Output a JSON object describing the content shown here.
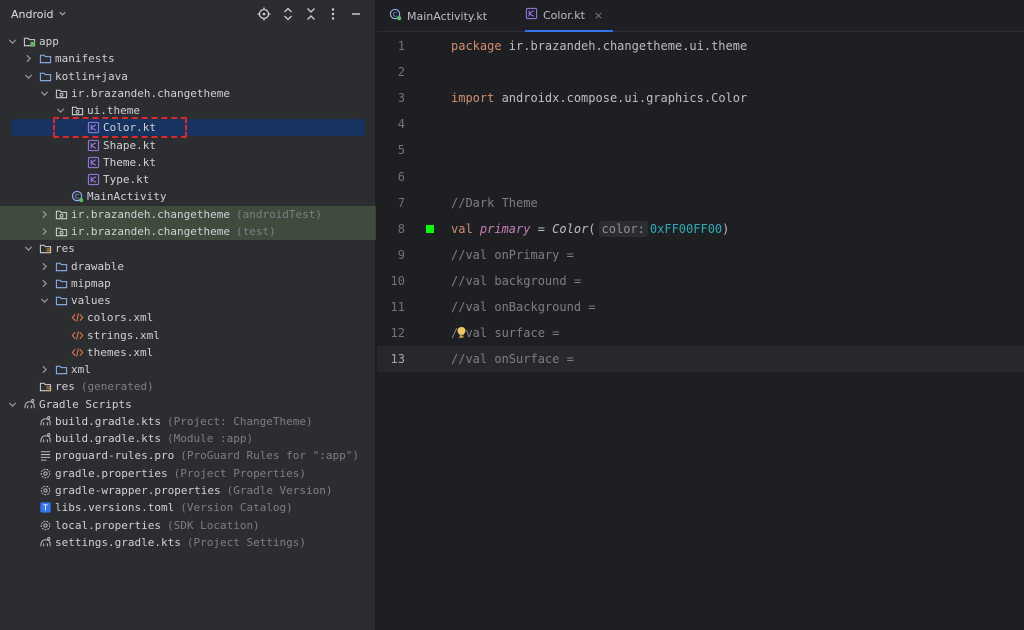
{
  "project_panel": {
    "view_label": "Android",
    "tree": [
      {
        "depth": 0,
        "label": "app",
        "hint": "",
        "icon": "module-folder-icon",
        "arrow": "down"
      },
      {
        "depth": 1,
        "label": "manifests",
        "hint": "",
        "icon": "folder-icon",
        "arrow": "right"
      },
      {
        "depth": 1,
        "label": "kotlin+java",
        "hint": "",
        "icon": "folder-icon",
        "arrow": "down"
      },
      {
        "depth": 2,
        "label": "ir.brazandeh.changetheme",
        "hint": "",
        "icon": "package-icon",
        "arrow": "down"
      },
      {
        "depth": 3,
        "label": "ui.theme",
        "hint": "",
        "icon": "package-icon",
        "arrow": "down"
      },
      {
        "depth": 4,
        "label": "Color.kt",
        "hint": "",
        "icon": "kotlin-file-icon",
        "arrow": "none",
        "selected": true
      },
      {
        "depth": 4,
        "label": "Shape.kt",
        "hint": "",
        "icon": "kotlin-file-icon",
        "arrow": "none"
      },
      {
        "depth": 4,
        "label": "Theme.kt",
        "hint": "",
        "icon": "kotlin-file-icon",
        "arrow": "none"
      },
      {
        "depth": 4,
        "label": "Type.kt",
        "hint": "",
        "icon": "kotlin-file-icon",
        "arrow": "none"
      },
      {
        "depth": 3,
        "label": "MainActivity",
        "hint": "",
        "icon": "activity-icon",
        "arrow": "none"
      },
      {
        "depth": 2,
        "label": "ir.brazandeh.changetheme",
        "hint": "(androidTest)",
        "icon": "package-icon",
        "arrow": "right",
        "test": true
      },
      {
        "depth": 2,
        "label": "ir.brazandeh.changetheme",
        "hint": "(test)",
        "icon": "package-icon",
        "arrow": "right",
        "test": true
      },
      {
        "depth": 1,
        "label": "res",
        "hint": "",
        "icon": "res-folder-icon",
        "arrow": "down"
      },
      {
        "depth": 2,
        "label": "drawable",
        "hint": "",
        "icon": "folder-icon",
        "arrow": "right"
      },
      {
        "depth": 2,
        "label": "mipmap",
        "hint": "",
        "icon": "folder-icon",
        "arrow": "right"
      },
      {
        "depth": 2,
        "label": "values",
        "hint": "",
        "icon": "folder-icon",
        "arrow": "down"
      },
      {
        "depth": 3,
        "label": "colors.xml",
        "hint": "",
        "icon": "xml-file-icon",
        "arrow": "none"
      },
      {
        "depth": 3,
        "label": "strings.xml",
        "hint": "",
        "icon": "xml-file-icon",
        "arrow": "none"
      },
      {
        "depth": 3,
        "label": "themes.xml",
        "hint": "",
        "icon": "xml-file-icon",
        "arrow": "none"
      },
      {
        "depth": 2,
        "label": "xml",
        "hint": "",
        "icon": "folder-icon",
        "arrow": "right"
      },
      {
        "depth": 1,
        "label": "res",
        "hint": "(generated)",
        "icon": "res-folder-icon",
        "arrow": "none"
      },
      {
        "depth": 0,
        "label": "Gradle Scripts",
        "hint": "",
        "icon": "gradle-icon",
        "arrow": "down"
      },
      {
        "depth": 1,
        "label": "build.gradle.kts",
        "hint": "(Project: ChangeTheme)",
        "icon": "gradle-icon",
        "arrow": "none"
      },
      {
        "depth": 1,
        "label": "build.gradle.kts",
        "hint": "(Module :app)",
        "icon": "gradle-icon",
        "arrow": "none"
      },
      {
        "depth": 1,
        "label": "proguard-rules.pro",
        "hint": "(ProGuard Rules for \":app\")",
        "icon": "text-file-icon",
        "arrow": "none"
      },
      {
        "depth": 1,
        "label": "gradle.properties",
        "hint": "(Project Properties)",
        "icon": "settings-file-icon",
        "arrow": "none"
      },
      {
        "depth": 1,
        "label": "gradle-wrapper.properties",
        "hint": "(Gradle Version)",
        "icon": "settings-file-icon",
        "arrow": "none"
      },
      {
        "depth": 1,
        "label": "libs.versions.toml",
        "hint": "(Version Catalog)",
        "icon": "toml-file-icon",
        "arrow": "none"
      },
      {
        "depth": 1,
        "label": "local.properties",
        "hint": "(SDK Location)",
        "icon": "settings-file-icon",
        "arrow": "none"
      },
      {
        "depth": 1,
        "label": "settings.gradle.kts",
        "hint": "(Project Settings)",
        "icon": "gradle-icon",
        "arrow": "none"
      }
    ]
  },
  "editor": {
    "tabs": [
      {
        "label": "MainActivity.kt",
        "icon": "activity-icon",
        "active": false
      },
      {
        "label": "Color.kt",
        "icon": "kotlin-file-icon",
        "active": true,
        "close": "×"
      }
    ],
    "lines": [
      {
        "num": "1",
        "tokens": [
          {
            "t": "kw",
            "v": "package "
          },
          {
            "t": "plain",
            "v": "ir.brazandeh.changetheme.ui.theme"
          }
        ]
      },
      {
        "num": "2",
        "tokens": []
      },
      {
        "num": "3",
        "tokens": [
          {
            "t": "kw",
            "v": "import "
          },
          {
            "t": "plain",
            "v": "androidx.compose.ui.graphics.Color"
          }
        ]
      },
      {
        "num": "4",
        "tokens": []
      },
      {
        "num": "5",
        "tokens": []
      },
      {
        "num": "6",
        "tokens": []
      },
      {
        "num": "7",
        "tokens": [
          {
            "t": "cmt",
            "v": "//Dark Theme"
          }
        ]
      },
      {
        "num": "8",
        "tokens": [
          {
            "t": "kw",
            "v": "val "
          },
          {
            "t": "prop",
            "v": "primary"
          },
          {
            "t": "plain",
            "v": " = "
          },
          {
            "t": "fn",
            "v": "Color"
          },
          {
            "t": "plain",
            "v": "("
          },
          {
            "t": "inlay",
            "v": "color:"
          },
          {
            "t": "num",
            "v": "0xFF00FF00"
          },
          {
            "t": "plain",
            "v": ")"
          }
        ],
        "swatch": "#00FF00"
      },
      {
        "num": "9",
        "tokens": [
          {
            "t": "cmt",
            "v": "//val onPrimary ="
          }
        ]
      },
      {
        "num": "10",
        "tokens": [
          {
            "t": "cmt",
            "v": "//val background ="
          }
        ]
      },
      {
        "num": "11",
        "tokens": [
          {
            "t": "cmt",
            "v": "//val onBackground ="
          }
        ]
      },
      {
        "num": "12",
        "tokens": [
          {
            "t": "cmt",
            "v": "//val surface ="
          }
        ],
        "bulb": true
      },
      {
        "num": "13",
        "tokens": [
          {
            "t": "cmt",
            "v": "//val onSurface ="
          }
        ],
        "current": true
      }
    ]
  },
  "colors": {
    "accent": "#3574F0",
    "selection": "#173360",
    "highlight_outline": "#E0262B",
    "swatch": "#00FF00"
  }
}
